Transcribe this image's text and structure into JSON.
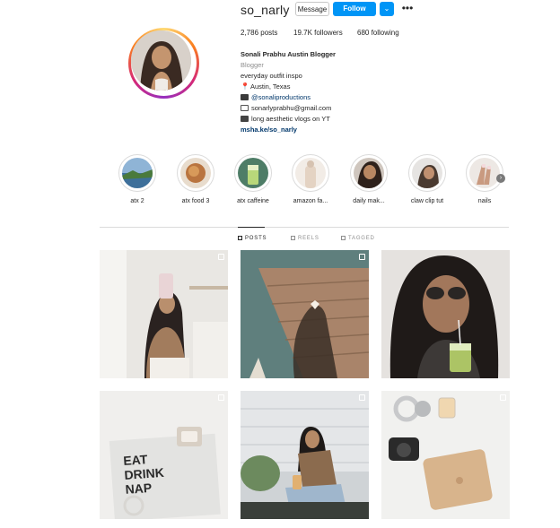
{
  "profile": {
    "username": "so_narly",
    "buttons": {
      "message": "Message",
      "follow": "Follow",
      "caret": "⌄",
      "more": "•••"
    },
    "stats": {
      "posts": "2,786 posts",
      "followers": "19.7K followers",
      "following": "680 following"
    },
    "bio": {
      "name": "Sonali Prabhu Austin Blogger",
      "category": "Blogger",
      "line1": "everyday outfit inspo",
      "location": "Austin, Texas",
      "tag": "@sonaliproductions",
      "email": "sonarlyprabhu@gmail.com",
      "vlog": "long aesthetic vlogs on YT",
      "link": "msha.ke/so_narly"
    }
  },
  "highlights": [
    {
      "label": "atx 2",
      "icon": "highlight-cover"
    },
    {
      "label": "atx food 3",
      "icon": "highlight-cover"
    },
    {
      "label": "atx caffeine",
      "icon": "highlight-cover"
    },
    {
      "label": "amazon fa...",
      "icon": "highlight-cover"
    },
    {
      "label": "daily mak...",
      "icon": "highlight-cover"
    },
    {
      "label": "claw clip tut",
      "icon": "highlight-cover"
    },
    {
      "label": "nails",
      "icon": "highlight-cover"
    }
  ],
  "tabs": {
    "posts": "POSTS",
    "reels": "REELS",
    "tagged": "TAGGED"
  },
  "colors": {
    "accent": "#0095f6",
    "link": "#00376b",
    "muted": "#8e8e8e"
  }
}
